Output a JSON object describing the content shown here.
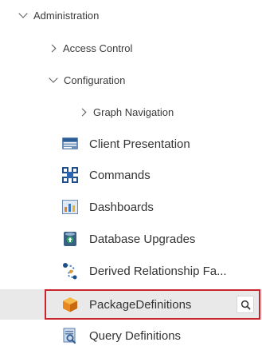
{
  "tree": {
    "administration": {
      "label": "Administration"
    },
    "access_control": {
      "label": "Access Control"
    },
    "configuration": {
      "label": "Configuration"
    },
    "graph_navigation": {
      "label": "Graph Navigation"
    },
    "items": [
      {
        "label": "Client Presentation",
        "icon": "client-presentation-icon"
      },
      {
        "label": "Commands",
        "icon": "commands-icon"
      },
      {
        "label": "Dashboards",
        "icon": "dashboards-icon"
      },
      {
        "label": "Database Upgrades",
        "icon": "database-upgrades-icon"
      },
      {
        "label": "Derived Relationship Fa...",
        "icon": "derived-relationship-icon"
      },
      {
        "label": "PackageDefinitions",
        "icon": "package-icon",
        "selected": true
      },
      {
        "label": "Query Definitions",
        "icon": "query-definitions-icon"
      }
    ]
  },
  "colors": {
    "selection_border": "#c8262c",
    "selection_background": "#e9e9e9"
  }
}
